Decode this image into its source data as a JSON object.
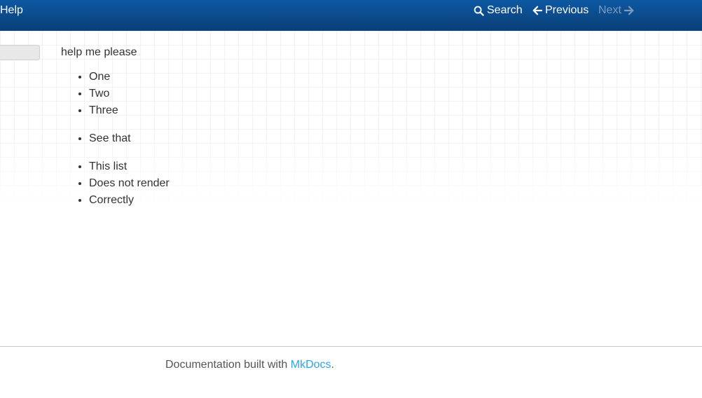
{
  "navbar": {
    "brand": "Help",
    "search_label": "Search",
    "previous_label": "Previous",
    "next_label": "Next"
  },
  "content": {
    "intro": "help me please",
    "lists": [
      [
        "One",
        "Two",
        "Three"
      ],
      [
        "See that"
      ],
      [
        "This list",
        "Does not render",
        "Correctly"
      ]
    ]
  },
  "footer": {
    "text": "Documentation built with ",
    "link_label": "MkDocs",
    "suffix": "."
  },
  "colors": {
    "navbar_top": "#0d58a3",
    "navbar_bottom": "#0a3f77",
    "link": "#2fa4e7",
    "disabled_nav": "#7f9bbb"
  },
  "icons": [
    "search-icon",
    "arrow-left-icon",
    "arrow-right-icon"
  ]
}
